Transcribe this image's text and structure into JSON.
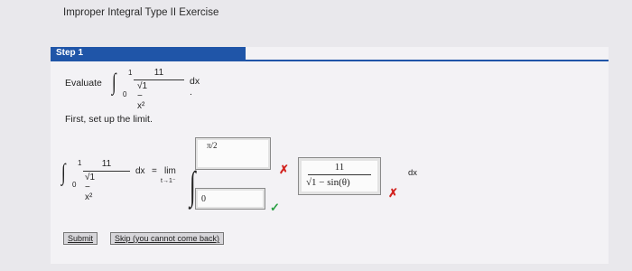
{
  "page": {
    "title": "Improper Integral Type II Exercise"
  },
  "step": {
    "label": "Step 1"
  },
  "evaluate": {
    "label": "Evaluate",
    "upper": "1",
    "lower": "0",
    "numerator": "11",
    "denominator": "√1 − x²",
    "differential": "dx ."
  },
  "instruction": "First, set up the limit.",
  "limit_expr": {
    "upper": "1",
    "lower": "0",
    "numerator": "11",
    "denominator": "√1 − x²",
    "dx": "dx",
    "equals": "=",
    "lim": "lim",
    "lim_sub": "t→1⁻"
  },
  "answers": {
    "upper_limit_value": "π/2",
    "lower_limit_value": "0",
    "integrand_numerator": "11",
    "integrand_denominator": "√1 − sin(θ)",
    "differential": "dx"
  },
  "buttons": {
    "submit": "Submit",
    "skip": "Skip (you cannot come back)"
  },
  "status": {
    "upper_limit": "incorrect",
    "lower_limit": "correct",
    "integrand": "incorrect"
  },
  "colors": {
    "header": "#1f55a8",
    "incorrect": "#d2231f",
    "correct": "#2aa043"
  }
}
